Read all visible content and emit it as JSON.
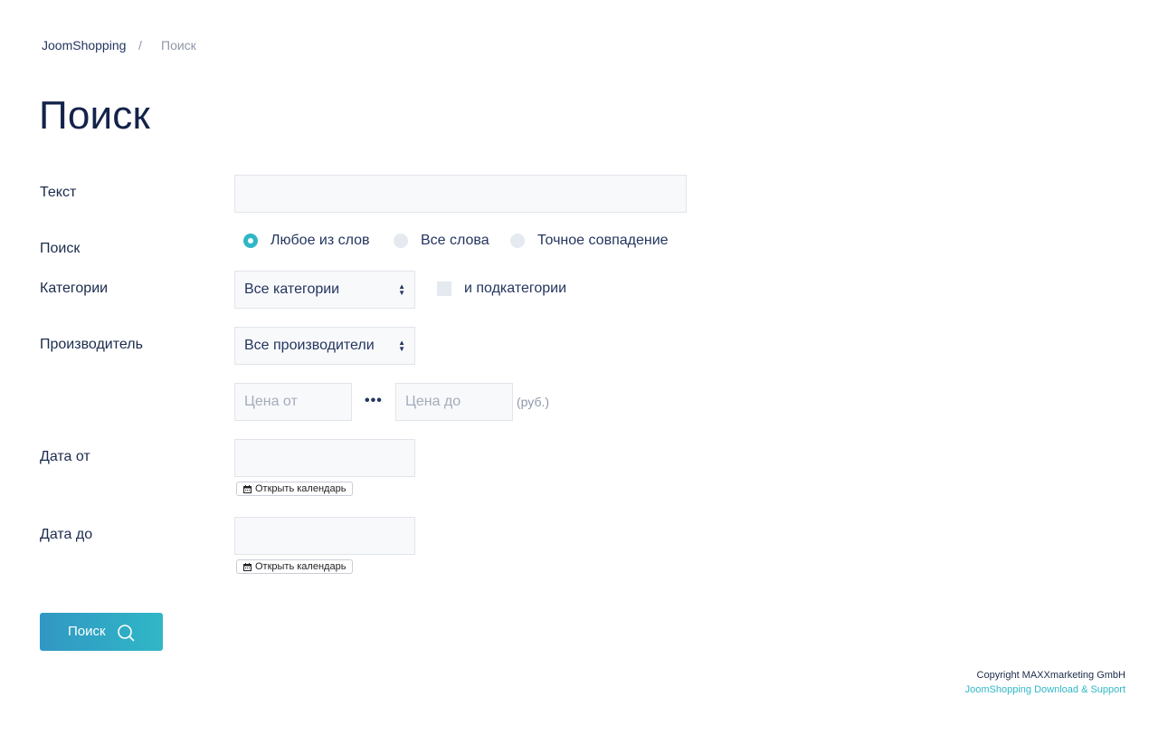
{
  "breadcrumb": {
    "home": "JoomShopping",
    "separator": "/",
    "current": "Поиск"
  },
  "page_title": "Поиск",
  "form": {
    "text_label": "Текст",
    "text_value": "",
    "search_mode_label": "Поиск",
    "search_modes": [
      {
        "label": "Любое из слов",
        "checked": true
      },
      {
        "label": "Все слова",
        "checked": false
      },
      {
        "label": "Точное совпадение",
        "checked": false
      }
    ],
    "category_label": "Категории",
    "category_selected": "Все категории",
    "subcategories_label": "и подкатегории",
    "subcategories_checked": false,
    "manufacturer_label": "Производитель",
    "manufacturer_selected": "Все производители",
    "price_from_placeholder": "Цена от",
    "price_separator": "•••",
    "price_to_placeholder": "Цена до",
    "currency": "(руб.)",
    "date_from_label": "Дата от",
    "date_from_value": "",
    "date_to_label": "Дата до",
    "date_to_value": "",
    "calendar_button_label": "Открыть календарь",
    "submit_label": "Поиск"
  },
  "footer": {
    "copyright": "Copyright MAXXmarketing GmbH",
    "support_link": "JoomShopping Download & Support"
  },
  "colors": {
    "accent": "#30b7c6",
    "button_gradient_start": "#3197c4",
    "title": "#14234a",
    "field_background": "#f8f9fb"
  },
  "icons": {
    "calendar": "calendar-icon",
    "search": "search-icon",
    "select_arrows": "sort-arrows-icon"
  }
}
